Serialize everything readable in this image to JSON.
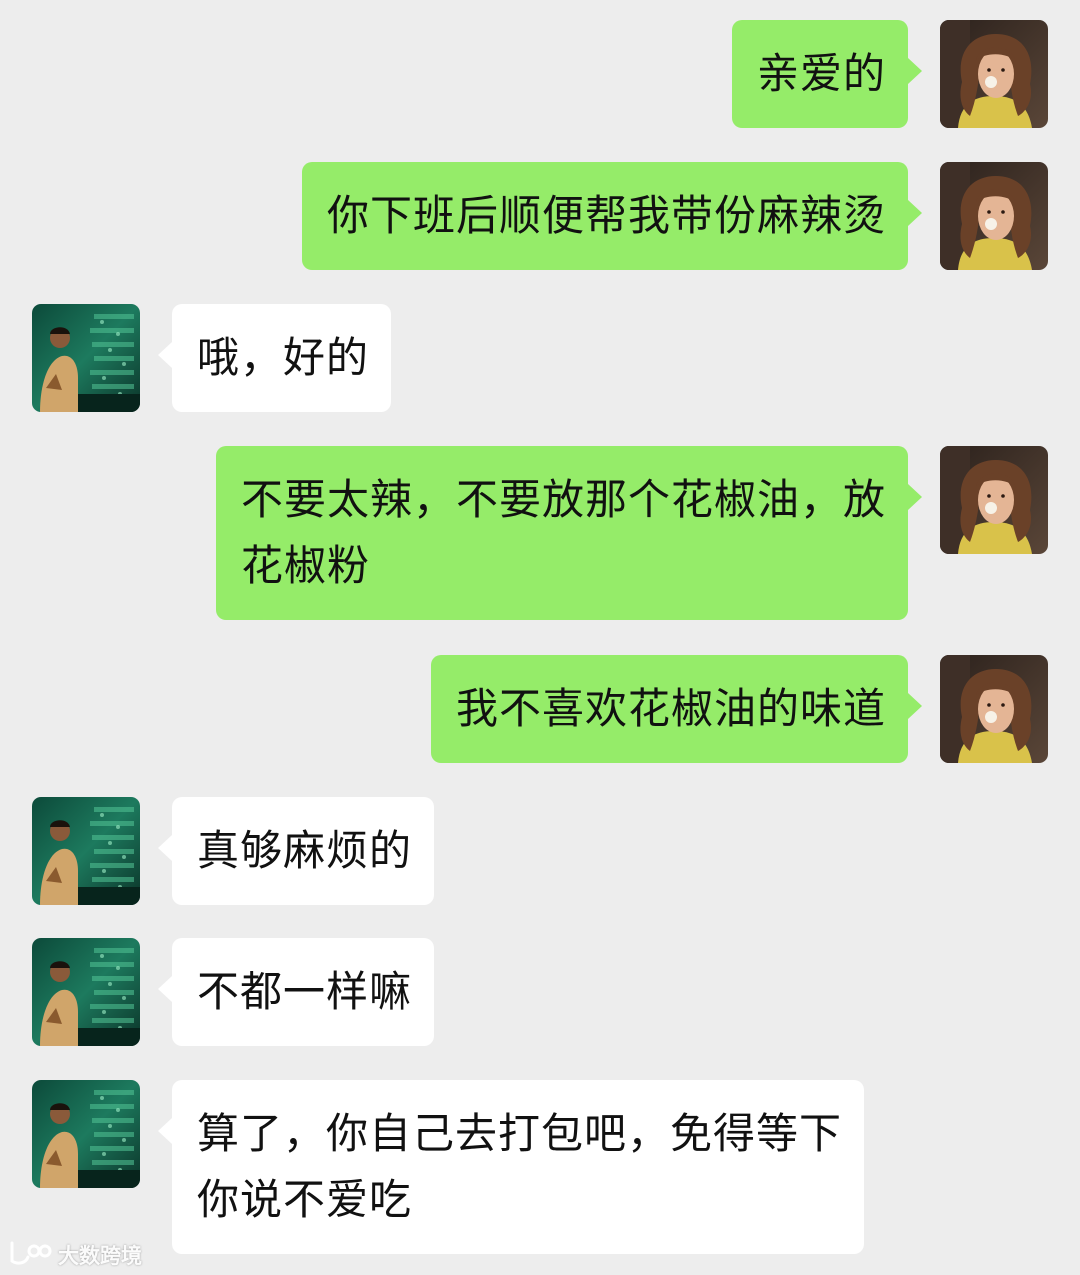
{
  "chat": {
    "messages": [
      {
        "sender": "me",
        "avatar": "curly-hair-woman-avatar",
        "text": "亲爱的"
      },
      {
        "sender": "me",
        "avatar": "curly-hair-woman-avatar",
        "text": "你下班后顺便帮我带份麻辣烫"
      },
      {
        "sender": "other",
        "avatar": "man-green-room-avatar",
        "text": "哦，好的"
      },
      {
        "sender": "me",
        "avatar": "curly-hair-woman-avatar",
        "text": "不要太辣，不要放那个花椒油，放\n花椒粉"
      },
      {
        "sender": "me",
        "avatar": "curly-hair-woman-avatar",
        "text": "我不喜欢花椒油的味道"
      },
      {
        "sender": "other",
        "avatar": "man-green-room-avatar",
        "text": "真够麻烦的"
      },
      {
        "sender": "other",
        "avatar": "man-green-room-avatar",
        "text": "不都一样嘛"
      },
      {
        "sender": "other",
        "avatar": "man-green-room-avatar",
        "text": "算了，你自己去打包吧，免得等下\n你说不爱吃"
      }
    ]
  },
  "colors": {
    "background": "#ededed",
    "my_bubble": "#95ec69",
    "other_bubble": "#ffffff",
    "text": "#111111"
  },
  "watermark": {
    "logo": "dashu-logo-icon",
    "text": "大数跨境"
  }
}
